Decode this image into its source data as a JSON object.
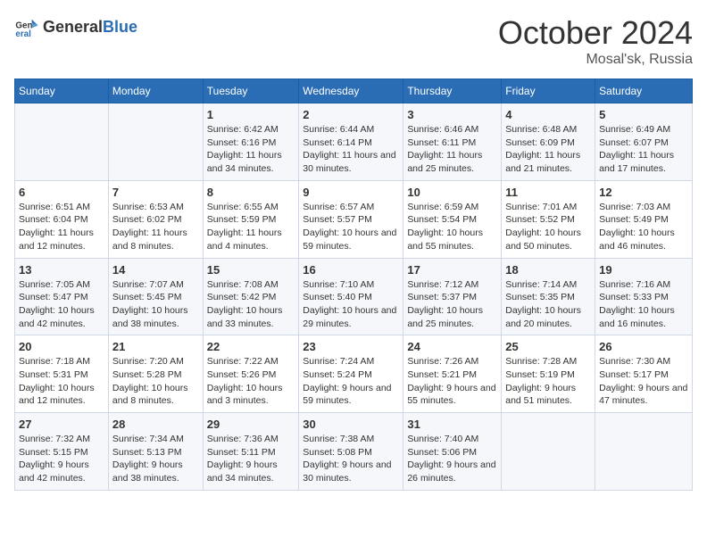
{
  "logo": {
    "text_general": "General",
    "text_blue": "Blue"
  },
  "header": {
    "month": "October 2024",
    "location": "Mosal'sk, Russia"
  },
  "weekdays": [
    "Sunday",
    "Monday",
    "Tuesday",
    "Wednesday",
    "Thursday",
    "Friday",
    "Saturday"
  ],
  "weeks": [
    [
      {
        "day": "",
        "sunrise": "",
        "sunset": "",
        "daylight": ""
      },
      {
        "day": "",
        "sunrise": "",
        "sunset": "",
        "daylight": ""
      },
      {
        "day": "1",
        "sunrise": "Sunrise: 6:42 AM",
        "sunset": "Sunset: 6:16 PM",
        "daylight": "Daylight: 11 hours and 34 minutes."
      },
      {
        "day": "2",
        "sunrise": "Sunrise: 6:44 AM",
        "sunset": "Sunset: 6:14 PM",
        "daylight": "Daylight: 11 hours and 30 minutes."
      },
      {
        "day": "3",
        "sunrise": "Sunrise: 6:46 AM",
        "sunset": "Sunset: 6:11 PM",
        "daylight": "Daylight: 11 hours and 25 minutes."
      },
      {
        "day": "4",
        "sunrise": "Sunrise: 6:48 AM",
        "sunset": "Sunset: 6:09 PM",
        "daylight": "Daylight: 11 hours and 21 minutes."
      },
      {
        "day": "5",
        "sunrise": "Sunrise: 6:49 AM",
        "sunset": "Sunset: 6:07 PM",
        "daylight": "Daylight: 11 hours and 17 minutes."
      }
    ],
    [
      {
        "day": "6",
        "sunrise": "Sunrise: 6:51 AM",
        "sunset": "Sunset: 6:04 PM",
        "daylight": "Daylight: 11 hours and 12 minutes."
      },
      {
        "day": "7",
        "sunrise": "Sunrise: 6:53 AM",
        "sunset": "Sunset: 6:02 PM",
        "daylight": "Daylight: 11 hours and 8 minutes."
      },
      {
        "day": "8",
        "sunrise": "Sunrise: 6:55 AM",
        "sunset": "Sunset: 5:59 PM",
        "daylight": "Daylight: 11 hours and 4 minutes."
      },
      {
        "day": "9",
        "sunrise": "Sunrise: 6:57 AM",
        "sunset": "Sunset: 5:57 PM",
        "daylight": "Daylight: 10 hours and 59 minutes."
      },
      {
        "day": "10",
        "sunrise": "Sunrise: 6:59 AM",
        "sunset": "Sunset: 5:54 PM",
        "daylight": "Daylight: 10 hours and 55 minutes."
      },
      {
        "day": "11",
        "sunrise": "Sunrise: 7:01 AM",
        "sunset": "Sunset: 5:52 PM",
        "daylight": "Daylight: 10 hours and 50 minutes."
      },
      {
        "day": "12",
        "sunrise": "Sunrise: 7:03 AM",
        "sunset": "Sunset: 5:49 PM",
        "daylight": "Daylight: 10 hours and 46 minutes."
      }
    ],
    [
      {
        "day": "13",
        "sunrise": "Sunrise: 7:05 AM",
        "sunset": "Sunset: 5:47 PM",
        "daylight": "Daylight: 10 hours and 42 minutes."
      },
      {
        "day": "14",
        "sunrise": "Sunrise: 7:07 AM",
        "sunset": "Sunset: 5:45 PM",
        "daylight": "Daylight: 10 hours and 38 minutes."
      },
      {
        "day": "15",
        "sunrise": "Sunrise: 7:08 AM",
        "sunset": "Sunset: 5:42 PM",
        "daylight": "Daylight: 10 hours and 33 minutes."
      },
      {
        "day": "16",
        "sunrise": "Sunrise: 7:10 AM",
        "sunset": "Sunset: 5:40 PM",
        "daylight": "Daylight: 10 hours and 29 minutes."
      },
      {
        "day": "17",
        "sunrise": "Sunrise: 7:12 AM",
        "sunset": "Sunset: 5:37 PM",
        "daylight": "Daylight: 10 hours and 25 minutes."
      },
      {
        "day": "18",
        "sunrise": "Sunrise: 7:14 AM",
        "sunset": "Sunset: 5:35 PM",
        "daylight": "Daylight: 10 hours and 20 minutes."
      },
      {
        "day": "19",
        "sunrise": "Sunrise: 7:16 AM",
        "sunset": "Sunset: 5:33 PM",
        "daylight": "Daylight: 10 hours and 16 minutes."
      }
    ],
    [
      {
        "day": "20",
        "sunrise": "Sunrise: 7:18 AM",
        "sunset": "Sunset: 5:31 PM",
        "daylight": "Daylight: 10 hours and 12 minutes."
      },
      {
        "day": "21",
        "sunrise": "Sunrise: 7:20 AM",
        "sunset": "Sunset: 5:28 PM",
        "daylight": "Daylight: 10 hours and 8 minutes."
      },
      {
        "day": "22",
        "sunrise": "Sunrise: 7:22 AM",
        "sunset": "Sunset: 5:26 PM",
        "daylight": "Daylight: 10 hours and 3 minutes."
      },
      {
        "day": "23",
        "sunrise": "Sunrise: 7:24 AM",
        "sunset": "Sunset: 5:24 PM",
        "daylight": "Daylight: 9 hours and 59 minutes."
      },
      {
        "day": "24",
        "sunrise": "Sunrise: 7:26 AM",
        "sunset": "Sunset: 5:21 PM",
        "daylight": "Daylight: 9 hours and 55 minutes."
      },
      {
        "day": "25",
        "sunrise": "Sunrise: 7:28 AM",
        "sunset": "Sunset: 5:19 PM",
        "daylight": "Daylight: 9 hours and 51 minutes."
      },
      {
        "day": "26",
        "sunrise": "Sunrise: 7:30 AM",
        "sunset": "Sunset: 5:17 PM",
        "daylight": "Daylight: 9 hours and 47 minutes."
      }
    ],
    [
      {
        "day": "27",
        "sunrise": "Sunrise: 7:32 AM",
        "sunset": "Sunset: 5:15 PM",
        "daylight": "Daylight: 9 hours and 42 minutes."
      },
      {
        "day": "28",
        "sunrise": "Sunrise: 7:34 AM",
        "sunset": "Sunset: 5:13 PM",
        "daylight": "Daylight: 9 hours and 38 minutes."
      },
      {
        "day": "29",
        "sunrise": "Sunrise: 7:36 AM",
        "sunset": "Sunset: 5:11 PM",
        "daylight": "Daylight: 9 hours and 34 minutes."
      },
      {
        "day": "30",
        "sunrise": "Sunrise: 7:38 AM",
        "sunset": "Sunset: 5:08 PM",
        "daylight": "Daylight: 9 hours and 30 minutes."
      },
      {
        "day": "31",
        "sunrise": "Sunrise: 7:40 AM",
        "sunset": "Sunset: 5:06 PM",
        "daylight": "Daylight: 9 hours and 26 minutes."
      },
      {
        "day": "",
        "sunrise": "",
        "sunset": "",
        "daylight": ""
      },
      {
        "day": "",
        "sunrise": "",
        "sunset": "",
        "daylight": ""
      }
    ]
  ]
}
